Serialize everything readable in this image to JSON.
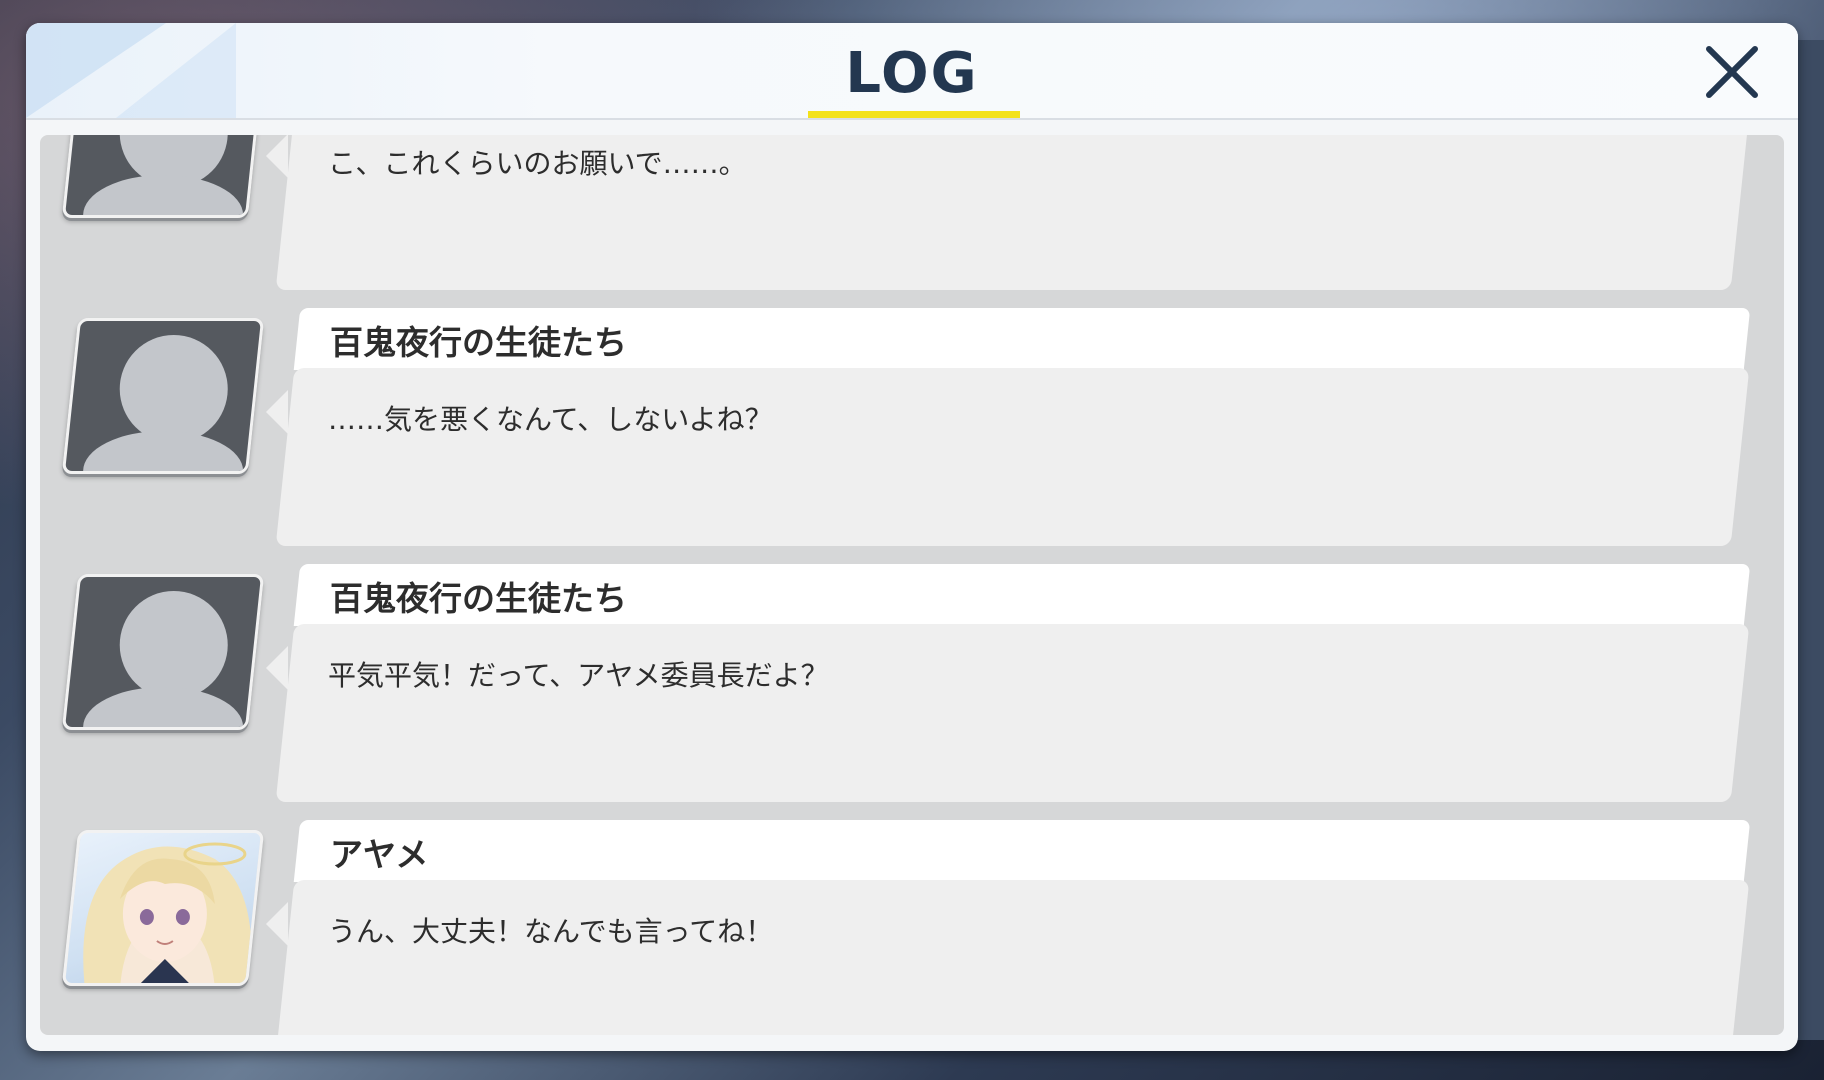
{
  "header": {
    "title": "LOG",
    "accent_color": "#f3e21b",
    "close_icon": "close-icon"
  },
  "log": {
    "entries": [
      {
        "speaker": "",
        "message": "こ、これくらいのお願いで……。",
        "avatar": "generic-silhouette"
      },
      {
        "speaker": "百鬼夜行の生徒たち",
        "message": "……気を悪くなんて、しないよね？",
        "avatar": "generic-silhouette"
      },
      {
        "speaker": "百鬼夜行の生徒たち",
        "message": "平気平気！だって、アヤメ委員長だよ？",
        "avatar": "generic-silhouette"
      },
      {
        "speaker": "アヤメ",
        "message": "うん、大丈夫！なんでも言ってね！",
        "avatar": "ayame-portrait"
      }
    ]
  }
}
